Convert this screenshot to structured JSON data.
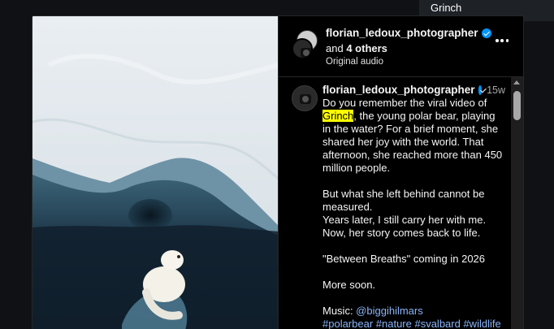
{
  "find": {
    "query": "Grinch"
  },
  "header": {
    "username": "florian_ledoux_photographer",
    "others_prefix": "and",
    "others_count": "4 others",
    "audio": "Original audio"
  },
  "caption": {
    "username": "florian_ledoux_photographer",
    "time": "15w",
    "line1_pre": "Do you remember the viral video of ",
    "line1_highlight": "Grinch",
    "line1_post": ", the young polar bear, playing in the water? For a brief moment, she shared her joy with the world. That afternoon, she reached more than 450 million people.",
    "para2": "But what she left behind cannot be measured.",
    "para3": "Years later, I still carry her with me.",
    "para4": "Now, her story comes back to life.",
    "para5": "\"Between Breaths\" coming in 2026",
    "para6": "More soon.",
    "music_label": "Music: ",
    "music_link": "@biggihilmars",
    "hashtags": "#polarbear #nature #svalbard #wildlife"
  },
  "icons": {
    "verified": "verified-badge-icon",
    "more": "more-options-icon",
    "scroll_up": "scroll-up-arrow-icon"
  },
  "colors": {
    "verified": "#0095f6",
    "highlight": "#ffff00",
    "link": "#8ab4f8"
  }
}
